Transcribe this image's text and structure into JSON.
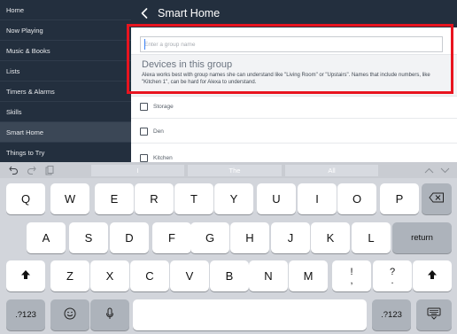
{
  "sidebar": {
    "items": [
      {
        "label": "Home"
      },
      {
        "label": "Now Playing"
      },
      {
        "label": "Music & Books"
      },
      {
        "label": "Lists"
      },
      {
        "label": "Timers & Alarms"
      },
      {
        "label": "Skills"
      },
      {
        "label": "Smart Home",
        "active": true
      },
      {
        "label": "Things to Try"
      }
    ]
  },
  "header": {
    "back_icon": "chevron-left-icon",
    "title": "Smart Home"
  },
  "group_name": {
    "placeholder": "Enter a group name",
    "value": ""
  },
  "devices": {
    "heading": "Devices in this group",
    "description": "Alexa works best with group names she can understand like \"Living Room\" or \"Upstairs\". Names that include numbers, like \"Kitchen 1\", can be hard for Alexa to understand.",
    "items": [
      {
        "label": "Storage",
        "checked": false
      },
      {
        "label": "Den",
        "checked": false
      },
      {
        "label": "Kitchen",
        "checked": false
      }
    ]
  },
  "keyboard": {
    "toolbar_icons": [
      "undo-icon",
      "redo-icon",
      "paste-icon"
    ],
    "suggestions": [
      "I",
      "The",
      "All"
    ],
    "nav_icons": [
      "chevron-up-icon",
      "chevron-down-icon"
    ],
    "row1": [
      "Q",
      "W",
      "E",
      "R",
      "T",
      "Y",
      "U",
      "I",
      "O",
      "P"
    ],
    "row2": [
      "A",
      "S",
      "D",
      "F",
      "G",
      "H",
      "J",
      "K",
      "L"
    ],
    "row3": [
      "Z",
      "X",
      "C",
      "V",
      "B",
      "N",
      "M"
    ],
    "punct1": {
      "top": "!",
      "bottom": ","
    },
    "punct2": {
      "top": "?",
      "bottom": "."
    },
    "return_label": "return",
    "numbers_label": ".?123",
    "icons": {
      "backspace": "backspace-icon",
      "shift": "shift-icon",
      "emoji": "emoji-icon",
      "mic": "microphone-icon",
      "dismiss": "keyboard-dismiss-icon"
    }
  },
  "colors": {
    "sidebar_bg": "#232f3e",
    "highlight": "#e8141f",
    "keyboard_bg": "#d2d5db"
  }
}
